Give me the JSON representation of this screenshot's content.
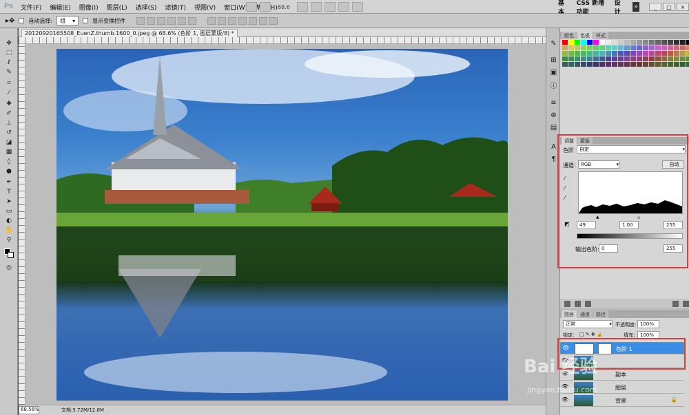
{
  "app": {
    "logo": "Ps"
  },
  "menubar": {
    "items": [
      "文件(F)",
      "编辑(E)",
      "图像(I)",
      "图层(L)",
      "选择(S)",
      "滤镜(T)",
      "视图(V)",
      "窗口(W)",
      "帮助(H)"
    ],
    "zoom": "68.6",
    "workspace": [
      "基本",
      "CSS 新增功能",
      "设计"
    ],
    "expand": "»"
  },
  "options": {
    "auto_select": "自动选择:",
    "group": "组",
    "show_transform": "显示变换控件"
  },
  "document": {
    "tab_title": "20120920165508_EuenZ.thumb.1600_0.jpeg @ 68.6% (色阶 1, 图层蒙版/8) *",
    "zoom": "68.56%",
    "doc_size": "文档:5.72M/12.8M"
  },
  "swatch_panel": {
    "tabs": [
      "颜色",
      "色板",
      "样式"
    ],
    "active": 1
  },
  "adjust_panel": {
    "tabs": [
      "调整",
      "蒙版"
    ],
    "title": "色阶",
    "preset": "自定",
    "channel_label": "通道:",
    "channel": "RGB",
    "auto": "自动",
    "input_black": "49",
    "input_gamma": "1.00",
    "input_white": "255",
    "output_label": "输出色阶:",
    "output_black": "0",
    "output_white": "255"
  },
  "layers_panel": {
    "tabs": [
      "图层",
      "通道",
      "路径"
    ],
    "blend": "正常",
    "opacity_label": "不透明度:",
    "opacity": "100%",
    "lock_label": "锁定:",
    "fill_label": "填充:",
    "fill": "100%",
    "layers": [
      {
        "name": "色阶 1",
        "selected": true
      },
      {
        "name": "",
        "selected": false
      },
      {
        "name": "副本",
        "selected": false
      },
      {
        "name": "图层",
        "selected": false
      },
      {
        "name": "背景",
        "selected": false
      }
    ]
  },
  "watermark": {
    "main": "Bai 经验",
    "url": "jingyan.baidu.com"
  },
  "colors": {
    "highlight": "#e53a3a",
    "selected_layer": "#3b8ee5"
  }
}
